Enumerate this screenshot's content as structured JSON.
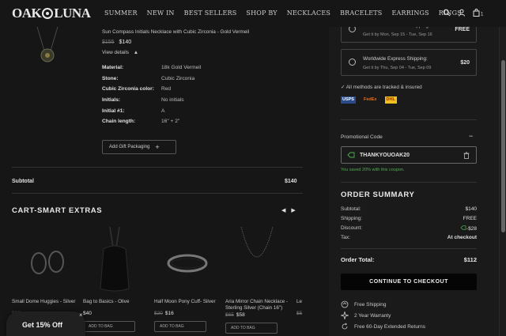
{
  "nav": {
    "logo": [
      "OAK",
      "LUNA"
    ],
    "menu": [
      "SUMMER",
      "NEW IN",
      "BEST SELLERS",
      "SHOP BY",
      "NECKLACES",
      "BRACELETS",
      "EARRINGS",
      "RINGS"
    ],
    "cart_count": "1",
    "icons": [
      "search-icon",
      "user-icon",
      "bag-icon"
    ]
  },
  "product": {
    "title": "Sun Compass Initials Necklace with Cubic Zirconia - Gold Vermeil",
    "old_price": "$155",
    "price": "$140",
    "view_details": "View details",
    "attributes": [
      {
        "key": "Material:",
        "value": "18k Gold Vermeil"
      },
      {
        "key": "Stone:",
        "value": "Cubic Zirconia"
      },
      {
        "key": "Cubic Zirconia color:",
        "value": "Red"
      },
      {
        "key": "Initials:",
        "value": "No initials"
      },
      {
        "key": "Initial #1:",
        "value": "A"
      },
      {
        "key": "Chain length:",
        "value": "16\" + 2\""
      }
    ],
    "gift_label": "Add Gift Packaging",
    "gift_icon": "plus-icon"
  },
  "subtotal": {
    "label": "Subtotal",
    "value": "$140"
  },
  "extras": {
    "title": "CART-SMART EXTRAS",
    "items": [
      {
        "name": "Small Dome Huggies - Silver",
        "old": "",
        "price": "$55"
      },
      {
        "name": "Bag to Basics - Olive",
        "old": "",
        "price": "$40"
      },
      {
        "name": "Half Moon Pony Cuff- Silver",
        "old": "$20",
        "price": "$16"
      },
      {
        "name": "Aria Mirror Chain Necklace - Sterling Silver (Chain 16\")",
        "old": "$65",
        "price": "$58"
      },
      {
        "name": "Le",
        "old": "$5",
        "price": ""
      }
    ],
    "add_label": "ADD TO BAG"
  },
  "promo_popup": {
    "label": "Get 15% Off",
    "close": "×"
  },
  "shipping": {
    "options": [
      {
        "title": "Worldwide Standard Shipping",
        "eta": "Get it by Mon, Sep 15 - Tue, Sep 16",
        "price": "FREE"
      },
      {
        "title": "Worldwide Express Shipping:",
        "eta": "Get it by Thu, Sep 04 - Tue, Sep 09",
        "price": "$20"
      }
    ],
    "tracked": "✓ All methods are tracked & insured",
    "carriers": [
      "USPS",
      "FedEx",
      "DHL"
    ]
  },
  "promo": {
    "label": "Promotional Code",
    "toggle": "−",
    "code": "THANKYOUOAK20",
    "saved": "You saved 20% with this coupon."
  },
  "summary": {
    "title": "ORDER SUMMARY",
    "rows": [
      {
        "label": "Subtotal:",
        "value": "$140"
      },
      {
        "label": "Shipping:",
        "value": "FREE"
      },
      {
        "label": "Discount:",
        "value": "-$28"
      },
      {
        "label": "Tax:",
        "value": "At checkout"
      }
    ],
    "total_label": "Order Total:",
    "total_value": "$112",
    "checkout_label": "CONTINUE TO CHECKOUT"
  },
  "perks": [
    {
      "icon": "truck-icon",
      "label": "Free Shipping"
    },
    {
      "icon": "sparkle-icon",
      "label": "2 Year Warranty"
    },
    {
      "icon": "return-icon",
      "label": "Free 60-Day Extended Returns"
    }
  ],
  "colors": {
    "background": "#161616",
    "panel": "#1a1a1a",
    "accent_green": "#4caf50",
    "button": "#050505"
  }
}
